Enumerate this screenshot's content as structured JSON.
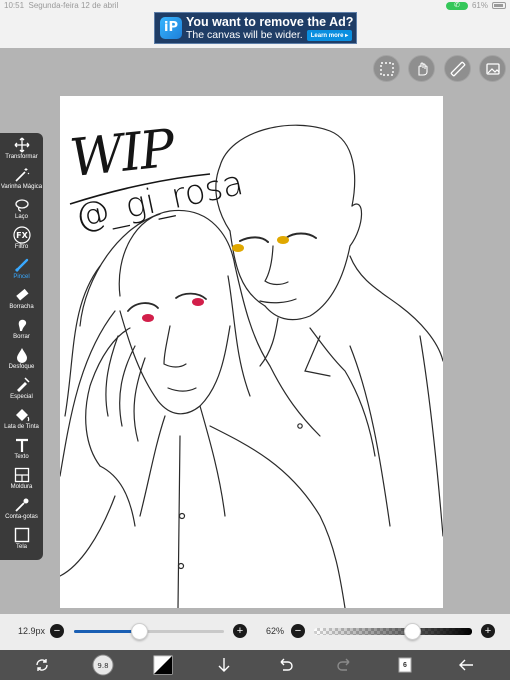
{
  "status_bar": {
    "time": "10:51",
    "date": "Segunda-feira 12 de abril",
    "battery": "61%",
    "phone_icon": "phone-icon"
  },
  "ad": {
    "logo_letters": "iP",
    "title": "You want to remove the Ad?",
    "subtitle": "The canvas will be wider.",
    "learn_more": "Learn more ▸"
  },
  "canvas": {
    "signature_title": "WIP",
    "signature_handle": "@_gi_rosa",
    "eye_colors": {
      "left_figure": "#d21f4a",
      "right_figure": "#e0a800"
    }
  },
  "tools": [
    {
      "label": "Transformar",
      "icon": "move-icon",
      "active": false
    },
    {
      "label": "Varinha Mágica",
      "icon": "magic-wand-icon",
      "active": false
    },
    {
      "label": "Laço",
      "icon": "lasso-icon",
      "active": false
    },
    {
      "label": "Filtro",
      "icon": "fx-icon",
      "active": false
    },
    {
      "label": "Pincel",
      "icon": "brush-icon",
      "active": true
    },
    {
      "label": "Borracha",
      "icon": "eraser-icon",
      "active": false
    },
    {
      "label": "Borrar",
      "icon": "smudge-icon",
      "active": false
    },
    {
      "label": "Desfoque",
      "icon": "blur-drop-icon",
      "active": false
    },
    {
      "label": "Especial",
      "icon": "special-pen-icon",
      "active": false
    },
    {
      "label": "Lata de Tinta",
      "icon": "paint-bucket-icon",
      "active": false
    },
    {
      "label": "Texto",
      "icon": "text-icon",
      "active": false
    },
    {
      "label": "Moldura",
      "icon": "frame-icon",
      "active": false
    },
    {
      "label": "Conta-gotas",
      "icon": "eyedropper-icon",
      "active": false
    },
    {
      "label": "Tela",
      "icon": "canvas-icon",
      "active": false
    }
  ],
  "brush_size": {
    "label": "12.9px",
    "fraction": 0.43
  },
  "brush_opacity": {
    "label": "62%",
    "fraction": 0.62
  },
  "bottom_bar": {
    "brush_badge": "9.8",
    "layers_count": "6"
  },
  "colors": {
    "accent": "#39a9ff",
    "palette_bg": "#3a3a3a",
    "toolbar_bg": "#505050",
    "slider_fill": "#1a5fb4"
  }
}
